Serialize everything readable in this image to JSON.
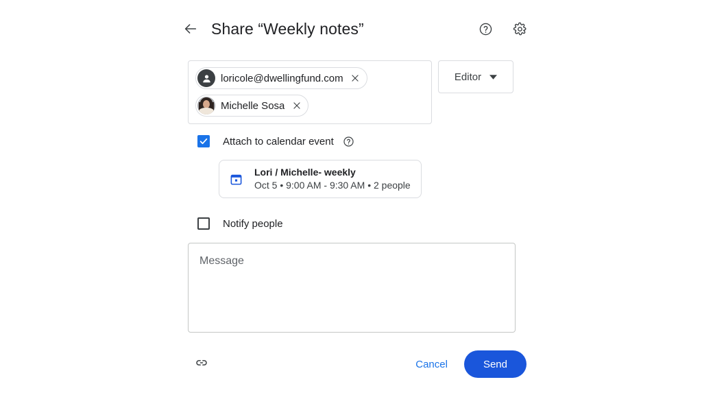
{
  "header": {
    "back_icon": "arrow-left-icon",
    "title": "Share “Weekly notes”",
    "help_icon": "help-circle-icon",
    "settings_icon": "gear-icon"
  },
  "recipients": {
    "chips": [
      {
        "label": "loricole@dwellingfund.com",
        "avatar": "generic-person-avatar",
        "remove_icon": "close-icon"
      },
      {
        "label": "Michelle Sosa",
        "avatar": "photo-avatar",
        "remove_icon": "close-icon"
      }
    ]
  },
  "role": {
    "selected": "Editor",
    "chevron_icon": "chevron-down-icon"
  },
  "attach": {
    "label": "Attach to calendar event",
    "checked": true,
    "help_icon": "help-circle-icon",
    "event": {
      "icon": "calendar-icon",
      "title": "Lori / Michelle- weekly",
      "subtitle": "Oct 5 • 9:00 AM - 9:30 AM • 2 people"
    }
  },
  "notify": {
    "label": "Notify people",
    "checked": false
  },
  "message": {
    "placeholder": "Message",
    "value": ""
  },
  "footer": {
    "link_icon": "link-icon",
    "cancel_label": "Cancel",
    "send_label": "Send"
  },
  "colors": {
    "accent_blue": "#1a73e8",
    "send_blue": "#1a56db",
    "border_gray": "#dadce0",
    "text_primary": "#202124",
    "text_secondary": "#5f6368"
  }
}
